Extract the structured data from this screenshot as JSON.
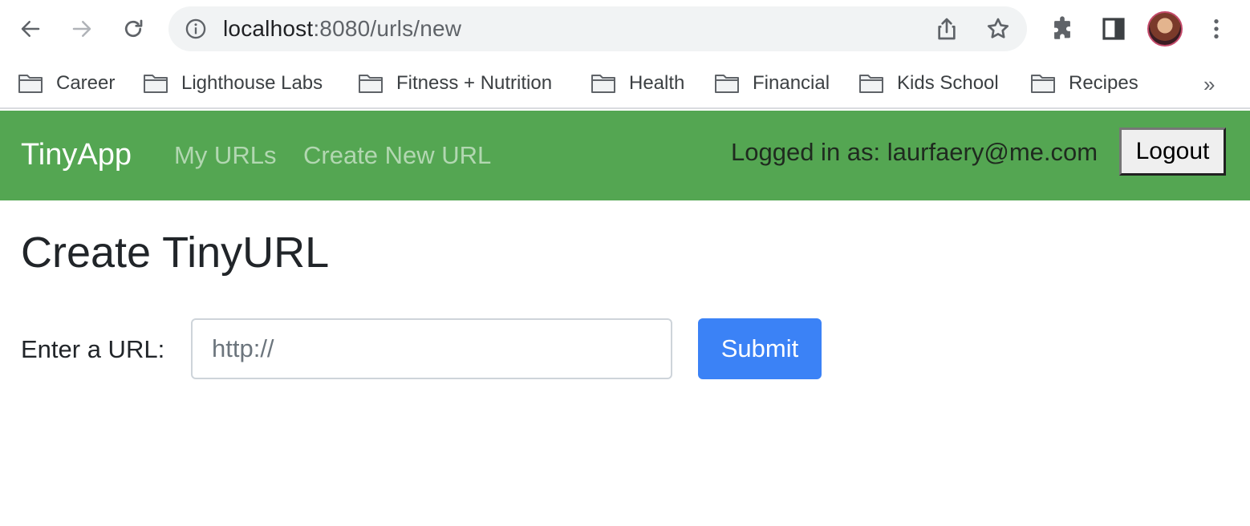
{
  "browser": {
    "url_host": "localhost",
    "url_path": ":8080/urls/new",
    "bookmarks": [
      {
        "label": "Career"
      },
      {
        "label": "Lighthouse Labs"
      },
      {
        "label": "Fitness + Nutrition"
      },
      {
        "label": "Health"
      },
      {
        "label": "Financial"
      },
      {
        "label": "Kids School"
      },
      {
        "label": "Recipes"
      }
    ],
    "bookmarks_more": "»"
  },
  "navbar": {
    "brand": "TinyApp",
    "links": [
      {
        "label": "My URLs"
      },
      {
        "label": "Create New URL"
      }
    ],
    "logged_in_text": "Logged in as: laurfaery@me.com",
    "logout_label": "Logout",
    "background_color": "#54a652"
  },
  "main": {
    "title": "Create TinyURL",
    "form": {
      "label": "Enter a URL:",
      "placeholder": "http://",
      "value": "",
      "submit_label": "Submit",
      "submit_color": "#3b82f6"
    }
  }
}
